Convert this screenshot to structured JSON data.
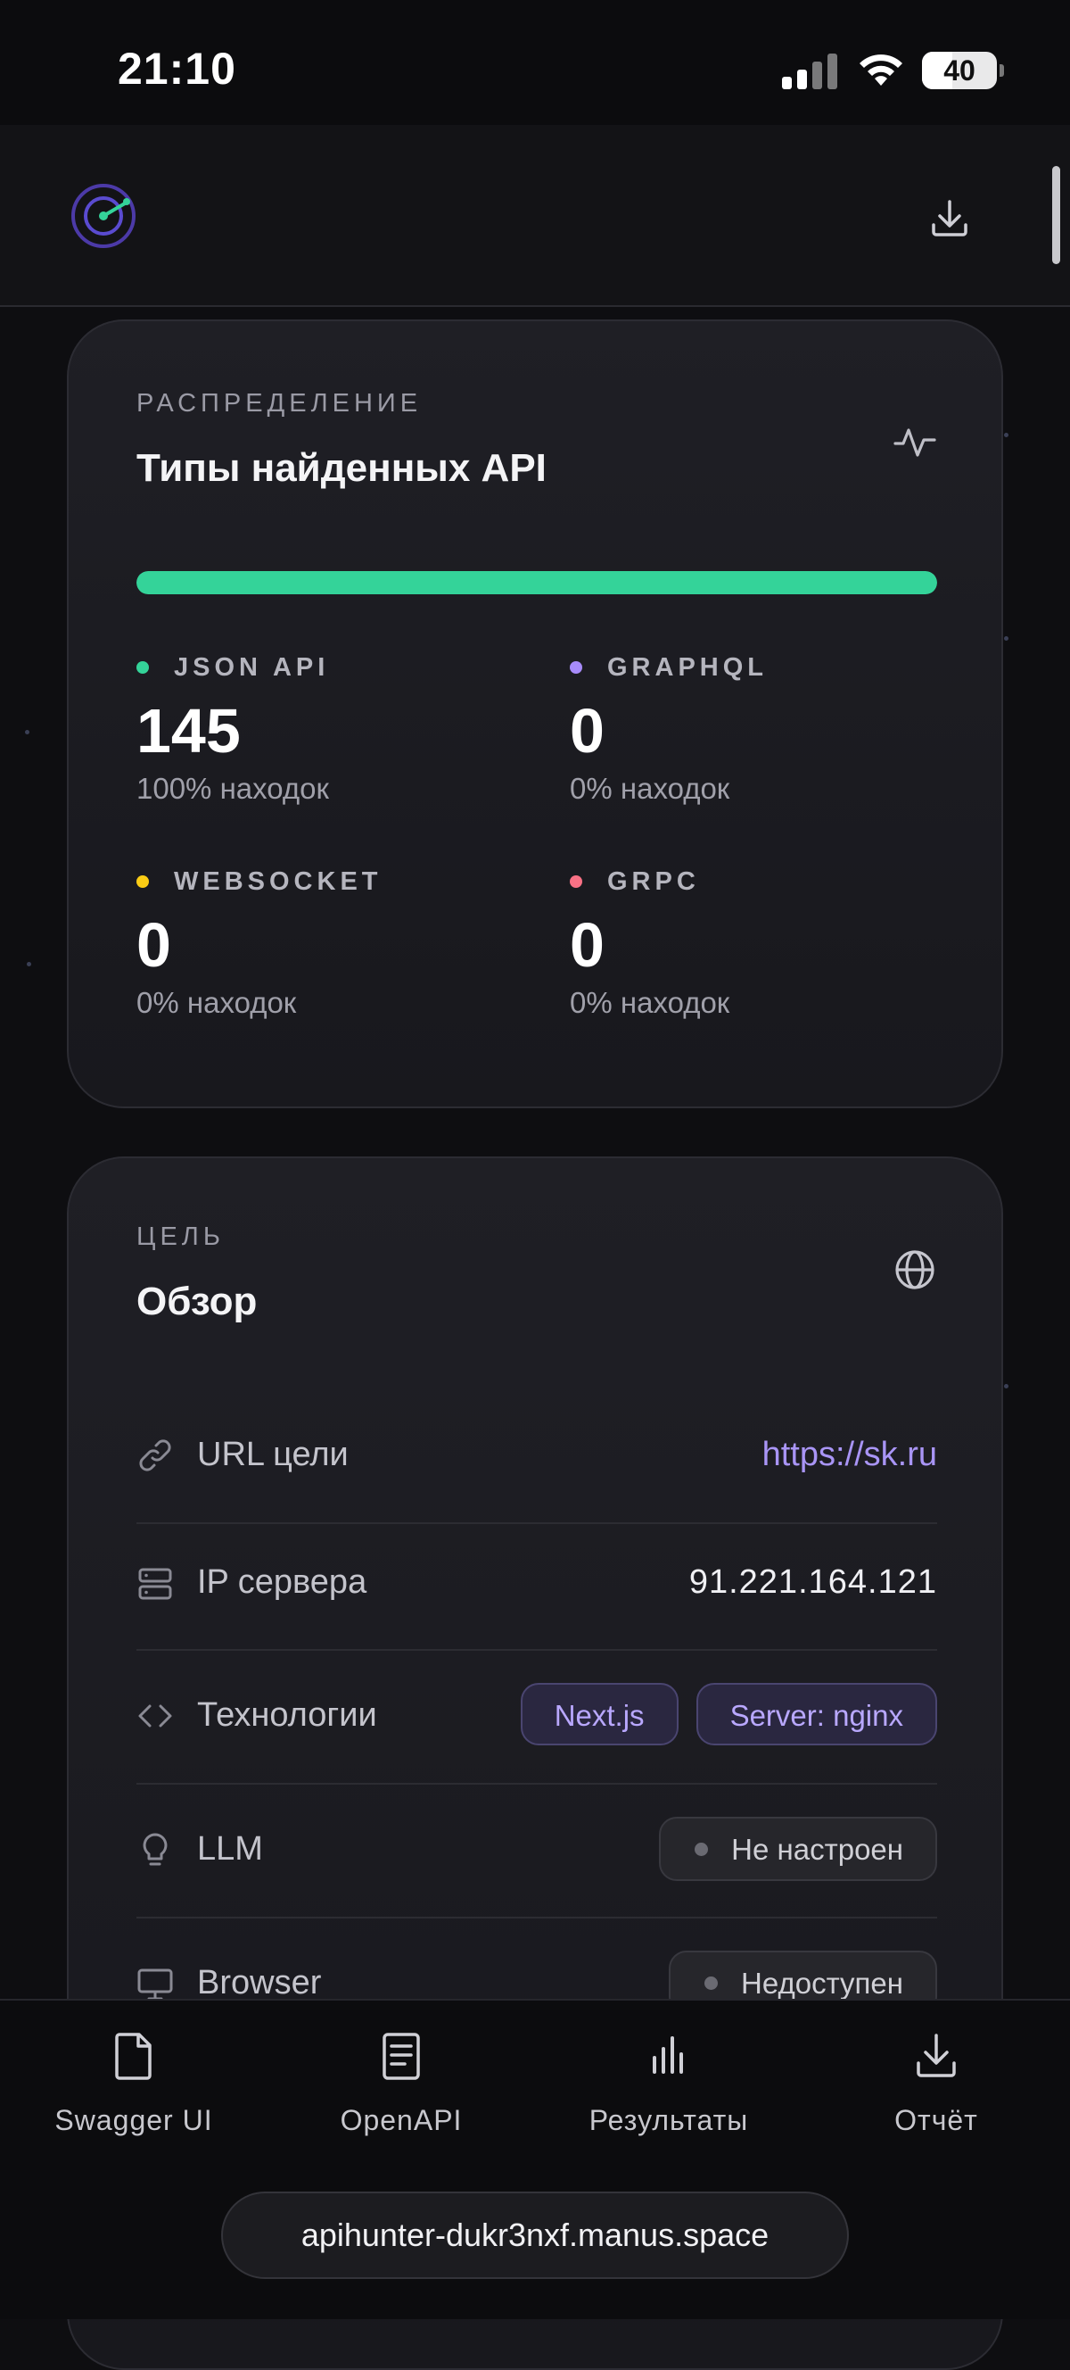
{
  "status_bar": {
    "time": "21:10",
    "battery": "40"
  },
  "card_types": {
    "eyebrow": "РАСПРЕДЕЛЕНИЕ",
    "title": "Типы найденных API",
    "distribution": {
      "json_api": 1.0,
      "graphql": 0.0,
      "websocket": 0.0,
      "grpc": 0.0
    },
    "stats": [
      {
        "label": "JSON API",
        "value": "145",
        "pct": "100% находок",
        "color": "#34d399"
      },
      {
        "label": "GRAPHQL",
        "value": "0",
        "pct": "0% находок",
        "color": "#a78bfa"
      },
      {
        "label": "WEBSOCKET",
        "value": "0",
        "pct": "0% находок",
        "color": "#facc15"
      },
      {
        "label": "GRPC",
        "value": "0",
        "pct": "0% находок",
        "color": "#f87185"
      }
    ]
  },
  "card_target": {
    "eyebrow": "ЦЕЛЬ",
    "title": "Обзор",
    "rows": {
      "url": {
        "label": "URL цели",
        "value": "https://sk.ru"
      },
      "ip": {
        "label": "IP сервера",
        "value": "91.221.164.121"
      },
      "tech": {
        "label": "Технологии",
        "chips": [
          "Next.js",
          "Server: nginx"
        ]
      },
      "llm": {
        "label": "LLM",
        "status": "Не настроен"
      },
      "browser": {
        "label": "Browser",
        "status": "Недоступен"
      }
    }
  },
  "bottom_nav": [
    {
      "label": "Swagger UI",
      "icon": "file-icon"
    },
    {
      "label": "OpenAPI",
      "icon": "document-icon"
    },
    {
      "label": "Результаты",
      "icon": "bar-chart-icon"
    },
    {
      "label": "Отчёт",
      "icon": "download-icon"
    }
  ],
  "browser": {
    "url": "apihunter-dukr3nxf.manus.space"
  }
}
